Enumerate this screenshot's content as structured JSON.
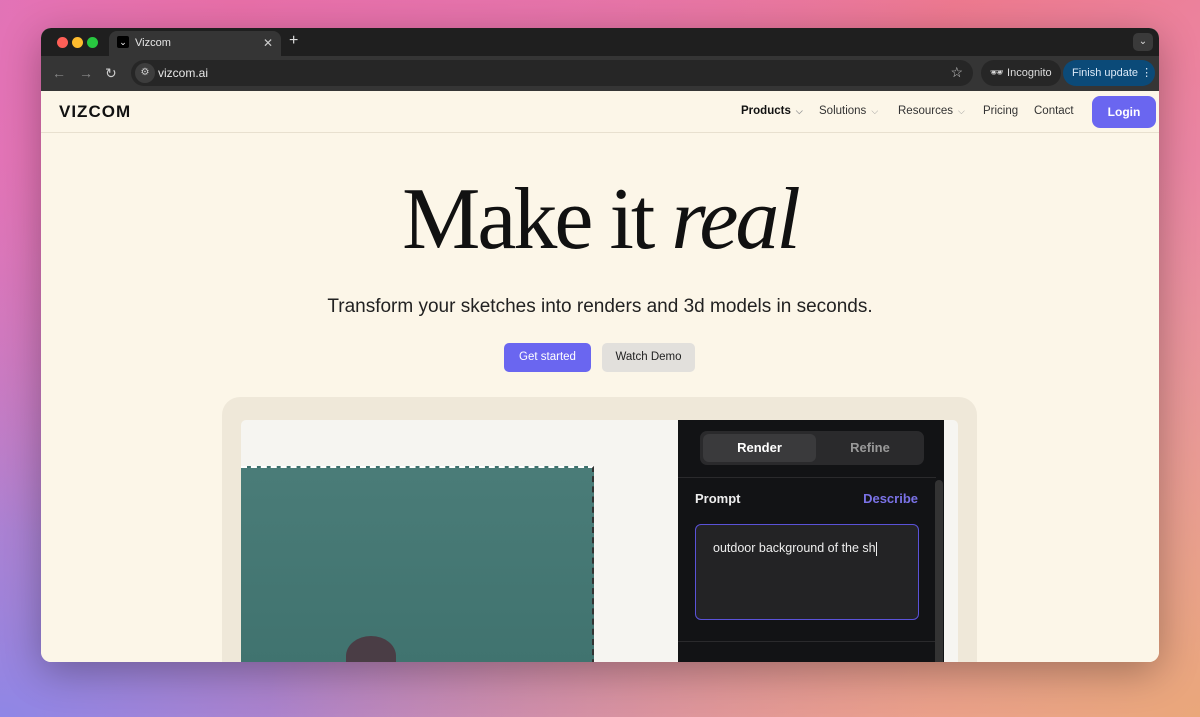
{
  "browser": {
    "tab_title": "Vizcom",
    "url": "vizcom.ai",
    "incognito_label": "Incognito",
    "update_label": "Finish update"
  },
  "site": {
    "logo": "VIZCOM",
    "nav": [
      {
        "label": "Products",
        "dropdown": true
      },
      {
        "label": "Solutions",
        "dropdown": true
      },
      {
        "label": "Resources",
        "dropdown": true
      },
      {
        "label": "Pricing"
      },
      {
        "label": "Contact"
      }
    ],
    "login_label": "Login"
  },
  "hero": {
    "headline_plain": "Make it ",
    "headline_italic": "real",
    "subtitle": "Transform your sketches into renders and 3d models in seconds.",
    "cta_primary": "Get started",
    "cta_secondary": "Watch Demo"
  },
  "demo": {
    "tabs": [
      "Render",
      "Refine"
    ],
    "active_tab": "Render",
    "prompt_label": "Prompt",
    "describe_label": "Describe",
    "prompt_value": "outdoor background of the sh"
  },
  "colors": {
    "accent": "#6a66f0",
    "background": "#fcf6e8",
    "panel": "#121315",
    "image": "#437673"
  }
}
